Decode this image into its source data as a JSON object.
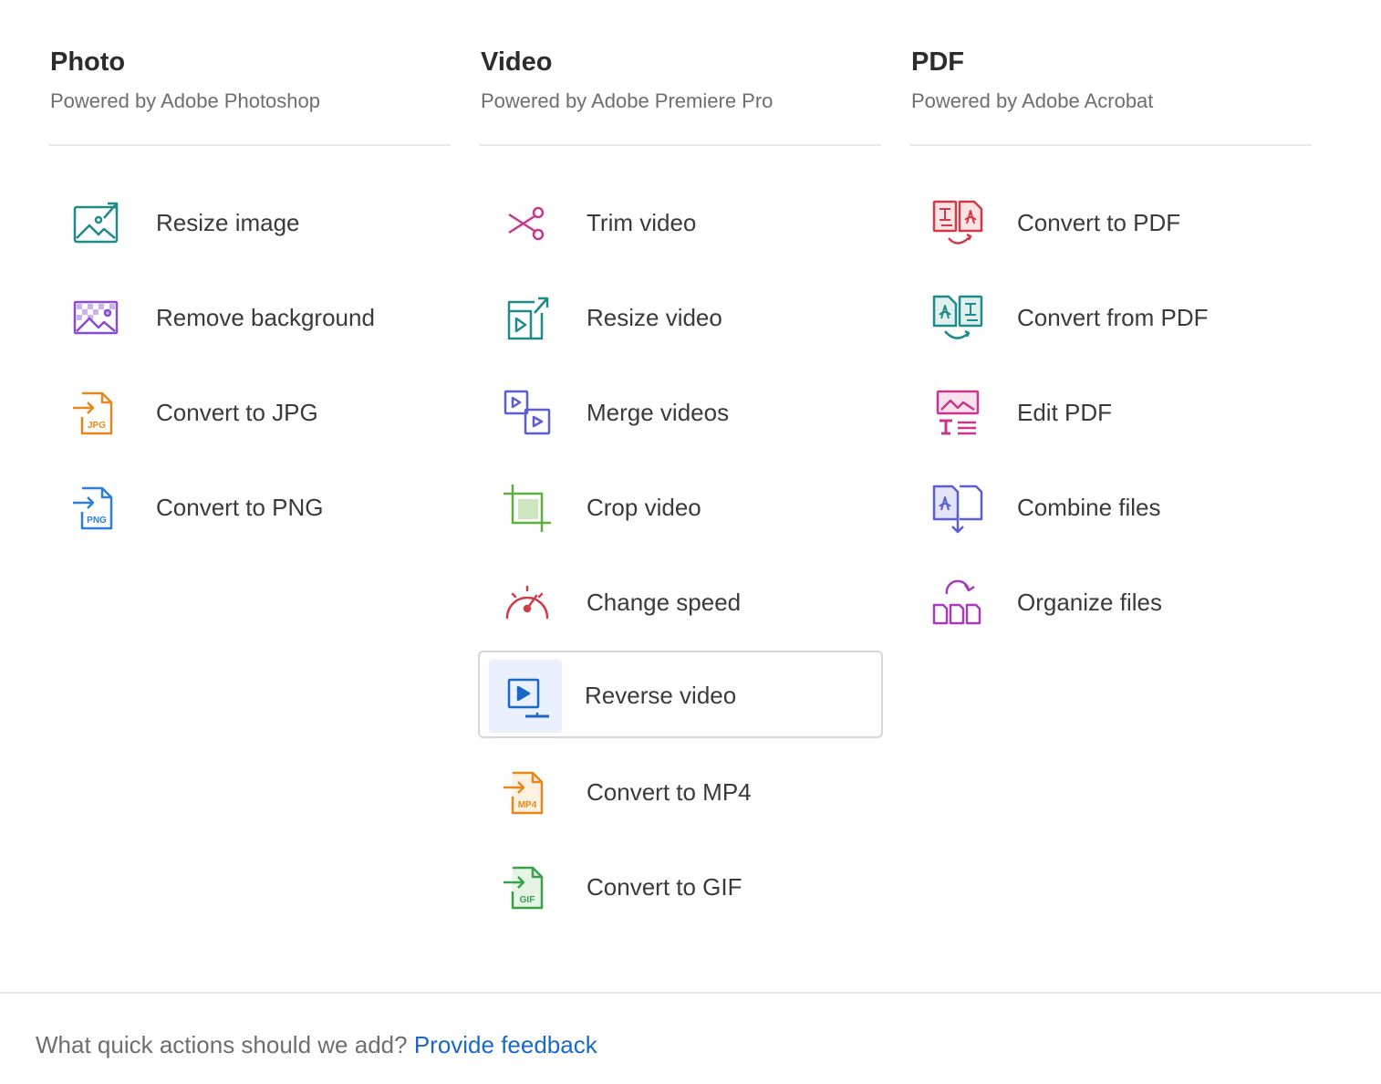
{
  "columns": [
    {
      "title": "Photo",
      "subtitle": "Powered by Adobe Photoshop",
      "items": [
        {
          "label": "Resize image",
          "icon": "resize-image-icon",
          "color": "#1f8a8a"
        },
        {
          "label": "Remove background",
          "icon": "remove-background-icon",
          "color": "#8a4bd1"
        },
        {
          "label": "Convert to JPG",
          "icon": "jpg-file-icon",
          "color": "#e6871a"
        },
        {
          "label": "Convert to PNG",
          "icon": "png-file-icon",
          "color": "#2b7fd6"
        }
      ]
    },
    {
      "title": "Video",
      "subtitle": "Powered by Adobe Premiere Pro",
      "items": [
        {
          "label": "Trim video",
          "icon": "scissors-icon",
          "color": "#c9358c"
        },
        {
          "label": "Resize video",
          "icon": "resize-video-icon",
          "color": "#1f8a8a"
        },
        {
          "label": "Merge videos",
          "icon": "merge-videos-icon",
          "color": "#5a5fd0"
        },
        {
          "label": "Crop video",
          "icon": "crop-icon",
          "color": "#5fae3f"
        },
        {
          "label": "Change speed",
          "icon": "speedometer-icon",
          "color": "#d03b4a"
        },
        {
          "label": "Reverse video",
          "icon": "reverse-video-icon",
          "color": "#1a68c8",
          "selected": true
        },
        {
          "label": "Convert to MP4",
          "icon": "mp4-file-icon",
          "color": "#e6871a"
        },
        {
          "label": "Convert to GIF",
          "icon": "gif-file-icon",
          "color": "#3aa04a"
        }
      ]
    },
    {
      "title": "PDF",
      "subtitle": "Powered by Adobe Acrobat",
      "items": [
        {
          "label": "Convert to PDF",
          "icon": "convert-to-pdf-icon",
          "color": "#d03b4a"
        },
        {
          "label": "Convert from PDF",
          "icon": "convert-from-pdf-icon",
          "color": "#1f8a8a"
        },
        {
          "label": "Edit PDF",
          "icon": "edit-pdf-icon",
          "color": "#c9358c"
        },
        {
          "label": "Combine files",
          "icon": "combine-files-icon",
          "color": "#5a5fd0"
        },
        {
          "label": "Organize files",
          "icon": "organize-files-icon",
          "color": "#a83bbd"
        }
      ]
    }
  ],
  "footer": {
    "question": "What quick actions should we add?",
    "link": "Provide feedback"
  }
}
